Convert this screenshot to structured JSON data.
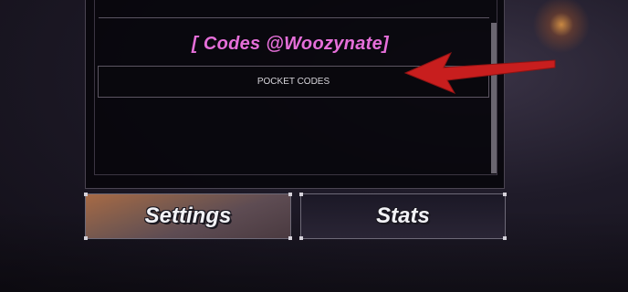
{
  "codes_panel": {
    "title": "[ Codes @Woozynate]",
    "code_box_text": "POCKET CODES"
  },
  "buttons": {
    "settings_label": "Settings",
    "stats_label": "Stats"
  },
  "icons": {
    "arrow": "red-arrow-pointer"
  },
  "colors": {
    "title": "#e56fd9",
    "arrow": "#c81e1e"
  }
}
